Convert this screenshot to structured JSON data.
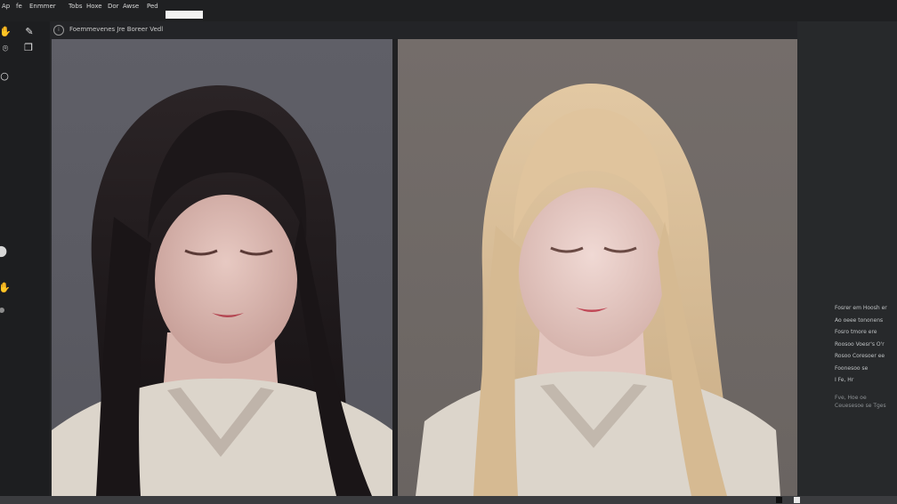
{
  "menubar": {
    "items": [
      "Ap",
      "fe",
      "Enmmer",
      "Tobs",
      "Hoxe",
      "Dor",
      "Awse",
      "Ped"
    ],
    "field_value": ""
  },
  "document": {
    "tab_title": "Foemmevenes Jre Boreer Vedl"
  },
  "panels": {
    "left": {
      "hair": "#1d1717",
      "background": "#5c5c64"
    },
    "right": {
      "hair": "#d8be98",
      "background": "#6f6966"
    }
  },
  "properties": {
    "items": [
      "Fosrer  em Hoosh er",
      "Ao  oeee  tononens",
      "Fosro  tmore  ere",
      "Roosoo  Voesr's  O'r",
      "Rosoo  Coresoer  ee",
      "Foonesoo  se",
      "I  Fe,  Hr"
    ],
    "dim_items": [
      "Fve,  Hoe  oe",
      "Ceuesesoe  se  Tges"
    ]
  },
  "colors": {
    "menubar_bg": "#1f2022",
    "toolbar_bg": "#1d1e20",
    "right_panel_bg": "#27292b",
    "statusbar_bg": "#3b3c3f"
  }
}
